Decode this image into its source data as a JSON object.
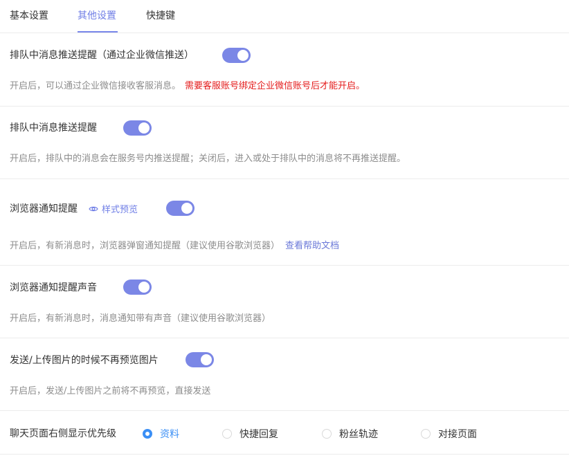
{
  "tabs": [
    {
      "label": "基本设置"
    },
    {
      "label": "其他设置"
    },
    {
      "label": "快捷键"
    }
  ],
  "active_tab": "其他设置",
  "settings": [
    {
      "title": "排队中消息推送提醒（通过企业微信推送）",
      "desc": "开启后，可以通过企业微信接收客服消息。",
      "warning": "需要客服账号绑定企业微信账号后才能开启。",
      "enabled": true
    },
    {
      "title": "排队中消息推送提醒",
      "desc": "开启后，排队中的消息会在服务号内推送提醒；关闭后，进入或处于排队中的消息将不再推送提醒。",
      "enabled": true
    },
    {
      "title": "浏览器通知提醒",
      "preview_label": "样式预览",
      "desc": "开启后，有新消息时，浏览器弹窗通知提醒（建议使用谷歌浏览器）",
      "link": "查看帮助文档",
      "enabled": true
    },
    {
      "title": "浏览器通知提醒声音",
      "desc": "开启后，有新消息时，消息通知带有声音（建议使用谷歌浏览器）",
      "enabled": true
    },
    {
      "title": "发送/上传图片的时候不再预览图片",
      "desc": "开启后，发送/上传图片之前将不再预览，直接发送",
      "enabled": true
    }
  ],
  "priority": {
    "title": "聊天页面右侧显示优先级",
    "options": [
      {
        "label": "资料",
        "checked": true
      },
      {
        "label": "快捷回复",
        "checked": false
      },
      {
        "label": "粉丝轨迹",
        "checked": false
      },
      {
        "label": "对接页面",
        "checked": false
      }
    ]
  },
  "colors": {
    "accent": "#7b87e6",
    "warning": "#e41b1b",
    "radio_checked": "#3b8ff5"
  }
}
